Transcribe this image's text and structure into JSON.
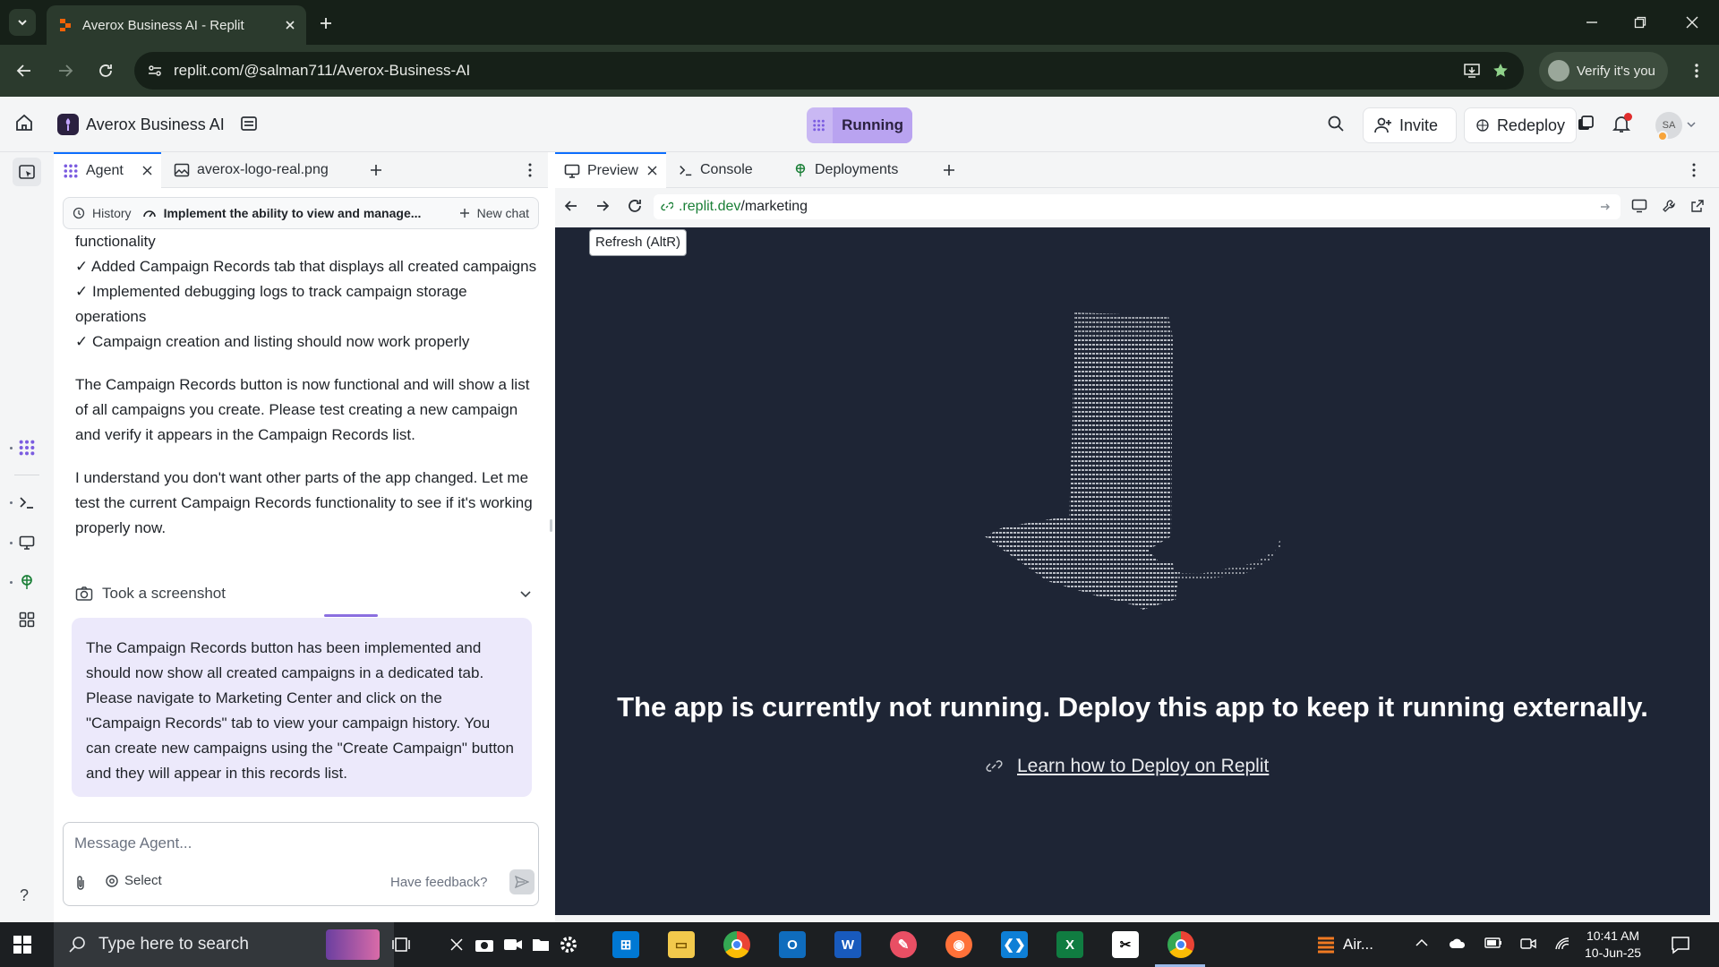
{
  "browser": {
    "tab_title": "Averox Business AI - Replit",
    "url": "replit.com/@salman711/Averox-Business-AI",
    "verify_label": "Verify it's you"
  },
  "header": {
    "project_name": "Averox Business AI",
    "status_label": "Running",
    "invite_label": "Invite",
    "redeploy_label": "Redeploy",
    "user_initials": "SA"
  },
  "agent_pane": {
    "tabs": [
      {
        "label": "Agent",
        "icon": "agent-icon",
        "active": true
      },
      {
        "label": "averox-logo-real.png",
        "icon": "image-icon",
        "active": false
      }
    ],
    "history_label": "History",
    "chat_title": "Implement the ability to view and manage...",
    "new_chat_label": "New chat",
    "messages": [
      "functionality",
      "✓ Added Campaign Records tab that displays all created campaigns",
      "✓ Implemented debugging logs to track campaign storage operations",
      "✓ Campaign creation and listing should now work properly",
      "The Campaign Records button is now functional and will show a list of all campaigns you create. Please test creating a new campaign and verify it appears in the Campaign Records list.",
      "I understand you don't want other parts of the app changed. Let me test the current Campaign Records functionality to see if it's working properly now."
    ],
    "action_label": "Took a screenshot",
    "bubble_text": "The Campaign Records button has been implemented and should now show all created campaigns in a dedicated tab. Please navigate to Marketing Center and click on the \"Campaign Records\" tab to view your campaign history. You can create new campaigns using the \"Create Campaign\" button and they will appear in this records list.",
    "input_placeholder": "Message Agent...",
    "select_label": "Select",
    "feedback_label": "Have feedback?",
    "help_label": "?"
  },
  "preview_pane": {
    "tabs": [
      {
        "label": "Preview",
        "icon": "monitor-icon",
        "active": true
      },
      {
        "label": "Console",
        "icon": "terminal-icon",
        "active": false
      },
      {
        "label": "Deployments",
        "icon": "deploy-icon",
        "active": false
      }
    ],
    "url_host": ".replit.dev",
    "url_path": "/marketing",
    "tooltip": "Refresh (AltR)",
    "not_running_text": "The app is currently not running. Deploy this app to keep it running externally.",
    "learn_link": "Learn how to Deploy on Replit"
  },
  "taskbar": {
    "search_placeholder": "Type here to search",
    "weather_label": "Air...",
    "time": "10:41 AM",
    "date": "10-Jun-25",
    "apps": [
      {
        "name": "store-icon",
        "color": "#0078d4"
      },
      {
        "name": "file-explorer-icon",
        "color": "#f2c94c"
      },
      {
        "name": "chrome-icon",
        "color": "#34a853"
      },
      {
        "name": "outlook-icon",
        "color": "#0f6cbd"
      },
      {
        "name": "word-icon",
        "color": "#185abd"
      },
      {
        "name": "paint-icon",
        "color": "#e94f64"
      },
      {
        "name": "firefox-icon",
        "color": "#ff7139"
      },
      {
        "name": "vscode-icon",
        "color": "#0e7fd6"
      },
      {
        "name": "excel-icon",
        "color": "#107c41"
      },
      {
        "name": "capcut-icon",
        "color": "#ffffff"
      },
      {
        "name": "chrome-active-icon",
        "color": "#34a853"
      }
    ]
  },
  "colors": {
    "accent": "#0d6efd",
    "running_bg": "#c9b8f3",
    "agent_bubble": "#ece9fb",
    "preview_bg": "#1e2535",
    "chrome_dark": "#162018"
  }
}
